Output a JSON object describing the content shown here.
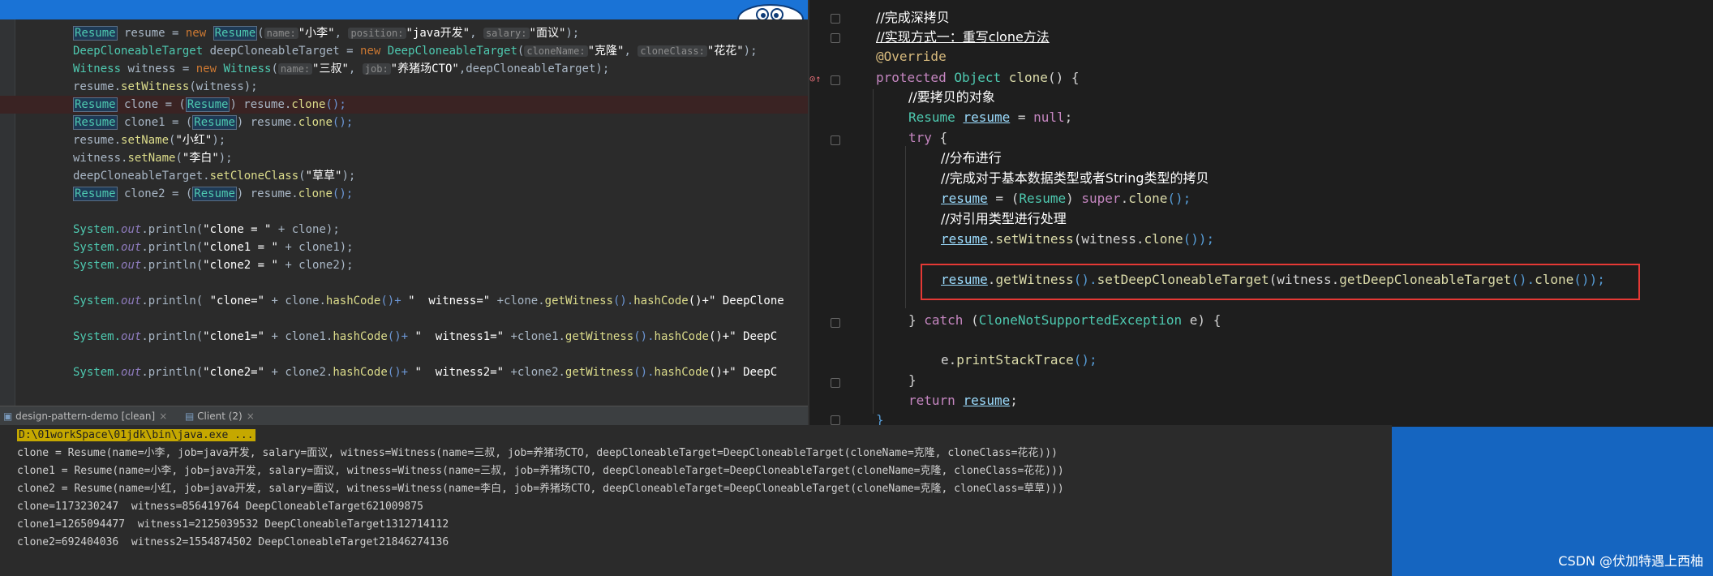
{
  "left_editor": {
    "hint_name": "name:",
    "hint_position": "position:",
    "hint_salary": "salary:",
    "hint_clonename": "cloneName:",
    "hint_cloneclass": "cloneClass:",
    "hint_job": "job:",
    "line1": {
      "a": "Resume",
      "b": " resume = ",
      "c": "new",
      "d": " ",
      "e": "Resume",
      "f": "(",
      "g": "\"小李\"",
      "h": ", ",
      "i": "\"java开发\"",
      "j": ", ",
      "k": "\"面议\"",
      "l": ");"
    },
    "line2": {
      "a": "DeepCloneableTarget",
      "b": " deepCloneableTarget = ",
      "c": "new",
      "d": " ",
      "e": "DeepCloneableTarget",
      "f": "(",
      "g": "\"克隆\"",
      "h": ", ",
      "i": "\"花花\"",
      "j": ");"
    },
    "line3": {
      "a": "Witness",
      "b": " witness = ",
      "c": "new",
      "d": " ",
      "e": "Witness",
      "f": "(",
      "g": "\"三叔\"",
      "h": ", ",
      "i": "\"养猪场CTO\"",
      "j": ",deepCloneableTarget);"
    },
    "line4": {
      "a": "resume.",
      "b": "setWitness",
      "c": "(witness);"
    },
    "line5": {
      "a": "Resume",
      "b": " clone = (",
      "c": "Resume",
      "d": ") resume.",
      "e": "clone",
      "f": "();"
    },
    "line6": {
      "a": "Resume",
      "b": " clone1 = (",
      "c": "Resume",
      "d": ") resume.",
      "e": "clone",
      "f": "();"
    },
    "line7": {
      "a": "resume.",
      "b": "setName",
      "c": "(",
      "d": "\"小红\"",
      "e": ");"
    },
    "line8": {
      "a": "witness.",
      "b": "setName",
      "c": "(",
      "d": "\"李白\"",
      "e": ");"
    },
    "line9": {
      "a": "deepCloneableTarget.",
      "b": "setCloneClass",
      "c": "(",
      "d": "\"草草\"",
      "e": ");"
    },
    "line10": {
      "a": "Resume",
      "b": " clone2 = (",
      "c": "Resume",
      "d": ") resume.",
      "e": "clone",
      "f": "();"
    },
    "line11": {
      "a": "System.",
      "b": "out",
      "c": ".println(",
      "d": "\"clone = \"",
      "e": " + clone);"
    },
    "line12": {
      "a": "System.",
      "b": "out",
      "c": ".println(",
      "d": "\"clone1 = \"",
      "e": " + clone1);"
    },
    "line13": {
      "a": "System.",
      "b": "out",
      "c": ".println(",
      "d": "\"clone2 = \"",
      "e": " + clone2);"
    },
    "line14": {
      "a": "System.",
      "b": "out",
      "c": ".println( ",
      "d": "\"clone=\"",
      "e": " + clone.",
      "f": "hashCode",
      "g": "()+ ",
      "h": "\"  witness=\"",
      "i": " +clone.",
      "j": "getWitness",
      "k": "().",
      "l": "hashCode",
      "m": "()+\" DeepClone"
    },
    "line15": {
      "a": "System.",
      "b": "out",
      "c": ".println(",
      "d": "\"clone1=\"",
      "e": " + clone1.",
      "f": "hashCode",
      "g": "()+ ",
      "h": "\"  witness1=\"",
      "i": " +clone1.",
      "j": "getWitness",
      "k": "().",
      "l": "hashCode",
      "m": "()+\" DeepC"
    },
    "line16": {
      "a": "System.",
      "b": "out",
      "c": ".println(",
      "d": "\"clone2=\"",
      "e": " + clone2.",
      "f": "hashCode",
      "g": "()+ ",
      "h": "\"  witness2=\"",
      "i": " +clone2.",
      "j": "getWitness",
      "k": "().",
      "l": "hashCode",
      "m": "()+\" DeepC"
    }
  },
  "right_editor": {
    "c1": "//完成深拷贝",
    "c2": "//实现方式一：重写clone方法",
    "ann": "@Override",
    "sig": {
      "a": "protected",
      "b": " Object ",
      "c": "clone",
      "d": "() {"
    },
    "c3": "//要拷贝的对象",
    "decl": {
      "a": "Resume",
      "b": " ",
      "c": "resume",
      "d": " = ",
      "e": "null",
      "f": ";"
    },
    "try": {
      "a": "try",
      "b": " {"
    },
    "c4": "//分布进行",
    "c5": "//完成对于基本数据类型或者String类型的拷贝",
    "assign": {
      "a": "resume",
      "b": " = (",
      "c": "Resume",
      "d": ") ",
      "e": "super",
      "f": ".",
      "g": "clone",
      "h": "();"
    },
    "c6": "//对引用类型进行处理",
    "setw": {
      "a": "resume",
      "b": ".",
      "c": "setWitness",
      "d": "(witness.",
      "e": "clone",
      "f": "());"
    },
    "boxed": {
      "a": "resume",
      "b": ".",
      "c": "getWitness",
      "d": "().",
      "e": "setDeepCloneableTarget",
      "f": "(witness.",
      "g": "getDeepCloneableTarget",
      "h": "().",
      "i": "clone",
      "j": "());"
    },
    "catch": {
      "a": "} ",
      "b": "catch",
      "c": " (",
      "d": "CloneNotSupportedException",
      "e": " e) {"
    },
    "pst": {
      "a": "e.",
      "b": "printStackTrace",
      "c": "();"
    },
    "close1": "}",
    "ret": {
      "a": "return",
      "b": " ",
      "c": "resume",
      "d": ";"
    },
    "close2": "}"
  },
  "run_panel": {
    "tab1": "design-pattern-demo [clean]",
    "tab2": "Client (2)",
    "close": "×"
  },
  "console": {
    "path": "D:\\01workSpace\\01jdk\\bin\\java.exe ...",
    "lines": [
      "clone = Resume(name=小李, job=java开发, salary=面议, witness=Witness(name=三叔, job=养猪场CTO, deepCloneableTarget=DeepCloneableTarget(cloneName=克隆, cloneClass=花花)))",
      "clone1 = Resume(name=小李, job=java开发, salary=面议, witness=Witness(name=三叔, job=养猪场CTO, deepCloneableTarget=DeepCloneableTarget(cloneName=克隆, cloneClass=花花)))",
      "clone2 = Resume(name=小红, job=java开发, salary=面议, witness=Witness(name=李白, job=养猪场CTO, deepCloneableTarget=DeepCloneableTarget(cloneName=克隆, cloneClass=草草)))",
      "clone=1173230247  witness=856419764 DeepCloneableTarget621009875",
      "clone1=1265094477  witness1=2125039532 DeepCloneableTarget1312714112",
      "clone2=692404036  witness2=1554874502 DeepCloneableTarget21846274136"
    ]
  },
  "watermark": "CSDN @伏加特遇上西柚"
}
